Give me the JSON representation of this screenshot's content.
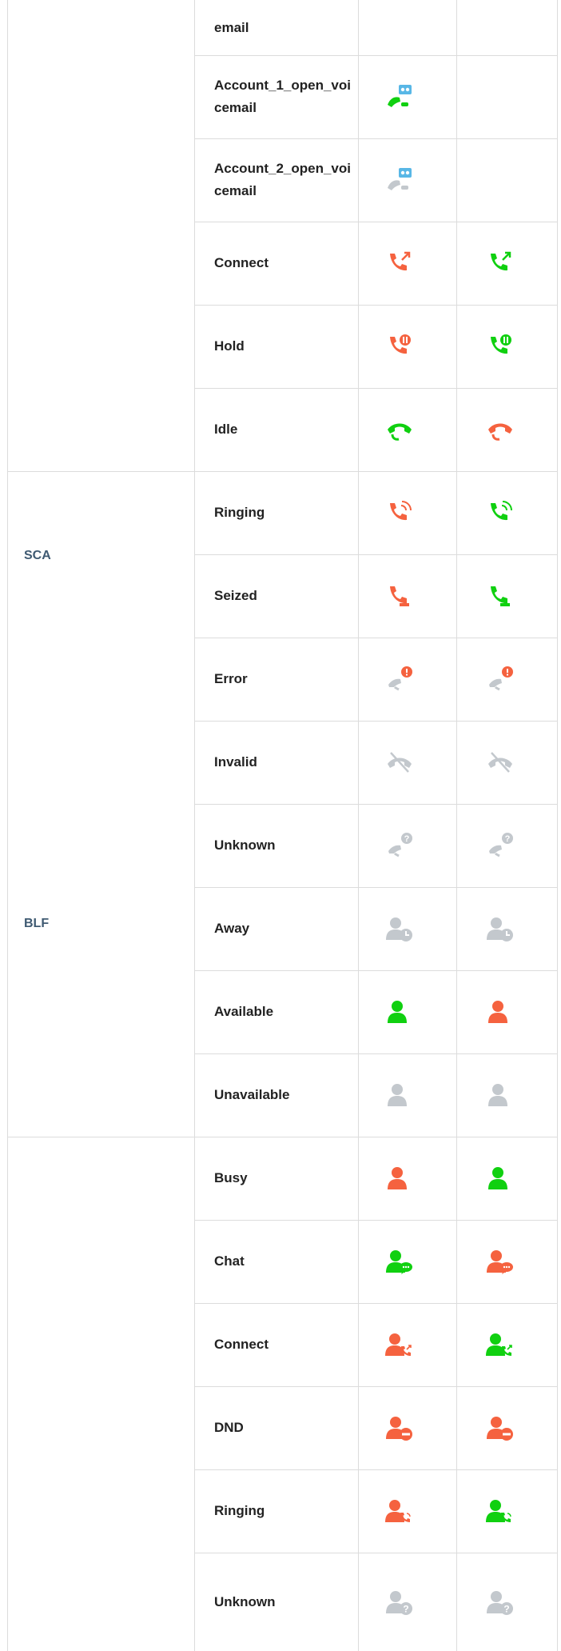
{
  "colors": {
    "green": "#10d010",
    "red": "#f5623f",
    "gray": "#c3c8cd",
    "blue": "#58b7e6",
    "label": "#3f5a72",
    "border": "#dcdcdc"
  },
  "groups": [
    {
      "label": ""
    },
    {
      "label": "SCA"
    },
    {
      "label": "BLF"
    },
    {
      "label": ""
    }
  ],
  "rows": [
    {
      "label": "email",
      "icons": [
        "",
        ""
      ]
    },
    {
      "label": "Account_1_open_voicemail",
      "icons": [
        "voicemail-green-icon",
        ""
      ]
    },
    {
      "label": "Account_2_open_voicemail",
      "icons": [
        "voicemail-gray-icon",
        ""
      ]
    },
    {
      "label": "Connect",
      "icons": [
        "phone-connect-red-icon",
        "phone-connect-green-icon"
      ]
    },
    {
      "label": "Hold",
      "icons": [
        "phone-hold-red-icon",
        "phone-hold-green-icon"
      ]
    },
    {
      "label": "Idle",
      "icons": [
        "phone-idle-green-icon",
        "phone-idle-red-icon"
      ]
    },
    {
      "label": "Ringing",
      "icons": [
        "phone-ringing-red-icon",
        "phone-ringing-green-icon"
      ]
    },
    {
      "label": "Seized",
      "icons": [
        "phone-seized-red-icon",
        "phone-seized-green-icon"
      ]
    },
    {
      "label": "Error",
      "icons": [
        "phone-error-gray-icon",
        "phone-error-gray-icon"
      ]
    },
    {
      "label": "Invalid",
      "icons": [
        "phone-invalid-gray-icon",
        "phone-invalid-gray-icon"
      ]
    },
    {
      "label": "Unknown",
      "icons": [
        "phone-unknown-gray-icon",
        "phone-unknown-gray-icon"
      ]
    },
    {
      "label": "Away",
      "icons": [
        "user-away-gray-icon",
        "user-away-gray-icon"
      ]
    },
    {
      "label": "Available",
      "icons": [
        "user-green-icon",
        "user-red-icon"
      ]
    },
    {
      "label": "Unavailable",
      "icons": [
        "user-gray-icon",
        "user-gray-icon"
      ]
    },
    {
      "label": "Busy",
      "icons": [
        "user-red-icon",
        "user-green-icon"
      ]
    },
    {
      "label": "Chat",
      "icons": [
        "user-chat-green-icon",
        "user-chat-red-icon"
      ]
    },
    {
      "label": "Connect",
      "icons": [
        "user-connect-red-icon",
        "user-connect-green-icon"
      ]
    },
    {
      "label": "DND",
      "icons": [
        "user-dnd-red-icon",
        "user-dnd-red-icon"
      ]
    },
    {
      "label": "Ringing",
      "icons": [
        "user-ringing-red-icon",
        "user-ringing-green-icon"
      ]
    },
    {
      "label": "Unknown",
      "icons": [
        "user-unknown-gray-icon",
        "user-unknown-gray-icon"
      ]
    }
  ]
}
